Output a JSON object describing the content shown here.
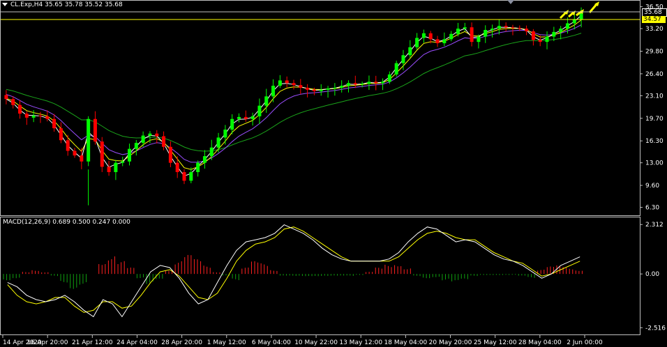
{
  "main_panel": {
    "symbol_info": "CL.Exp,H4  35.65 35.78 35.52 35.68",
    "price_axis_labels": [
      "36.50",
      "33.20",
      "29.80",
      "26.40",
      "23.10",
      "19.70",
      "16.30",
      "13.00",
      "9.60",
      "6.30"
    ],
    "price_axis_values": [
      36.5,
      33.2,
      29.8,
      26.4,
      23.1,
      19.7,
      16.3,
      13.0,
      9.6,
      6.3
    ],
    "bid_tag": "35.68",
    "ask_tag": "34.57",
    "ylim": [
      5.2,
      37.3
    ],
    "close_series": [
      22.6,
      21.7,
      20.4,
      19.8,
      20.1,
      20.0,
      19.6,
      18.2,
      16.4,
      14.8,
      14.1,
      13.2,
      19.6,
      16.2,
      12.4,
      11.6,
      13.0,
      13.2,
      15.1,
      16.0,
      17.1,
      17.4,
      17.0,
      15.4,
      13.0,
      11.6,
      10.3,
      11.6,
      13.0,
      14.0,
      15.3,
      16.8,
      18.0,
      19.6,
      19.9,
      19.6,
      20.0,
      21.6,
      23.0,
      24.6,
      25.4,
      25.0,
      24.7,
      24.3,
      24.0,
      23.8,
      24.0,
      24.2,
      24.3,
      24.6,
      25.0,
      24.8,
      24.9,
      25.2,
      25.0,
      25.2,
      26.3,
      28.0,
      29.2,
      30.4,
      31.8,
      32.5,
      31.6,
      31.0,
      31.6,
      32.4,
      33.2,
      33.4,
      31.2,
      32.0,
      33.0,
      33.2,
      33.6,
      33.4,
      33.3,
      33.2,
      32.8,
      31.5,
      31.2,
      32.0,
      32.7,
      33.2,
      34.0,
      34.57,
      35.68
    ],
    "indicator_colors": {
      "bull_candle": "#00ff00",
      "bear_candle": "#ff0000",
      "ma_fast": "#ffffff",
      "ma_mid": "#ffff00",
      "ma_slow": "#9a4dff",
      "ma_long": "#1aa31a",
      "signal_arrows": "#ffff00",
      "ask_line": "#ffff00",
      "bid_line": "#c0c0c0"
    }
  },
  "macd_panel": {
    "info": "MACD(12,26,9) 0.689 0.500 0.247 0.000",
    "axis_labels": [
      "2.312",
      "0.00",
      "-2.516"
    ],
    "axis_values": [
      2.312,
      0.0,
      -2.516
    ],
    "ylim": [
      -2.7,
      2.45
    ],
    "macd_line": [
      -0.4,
      -0.6,
      -1.0,
      -1.2,
      -1.3,
      -1.2,
      -1.0,
      -1.3,
      -1.7,
      -2.0,
      -1.2,
      -1.4,
      -2.0,
      -1.3,
      -0.6,
      0.1,
      0.4,
      0.3,
      -0.2,
      -0.9,
      -1.4,
      -1.2,
      -0.4,
      0.4,
      1.1,
      1.5,
      1.6,
      1.7,
      1.9,
      2.3,
      2.1,
      1.9,
      1.6,
      1.2,
      0.9,
      0.7,
      0.6,
      0.6,
      0.6,
      0.6,
      0.7,
      1.0,
      1.5,
      1.9,
      2.2,
      2.1,
      1.8,
      1.5,
      1.6,
      1.5,
      1.2,
      0.9,
      0.7,
      0.6,
      0.4,
      0.1,
      -0.2,
      0.0,
      0.4,
      0.6,
      0.8
    ],
    "signal_line": [
      -0.5,
      -1.0,
      -1.3,
      -1.4,
      -1.3,
      -1.1,
      -1.1,
      -1.5,
      -1.8,
      -1.7,
      -1.3,
      -1.3,
      -1.6,
      -1.5,
      -1.0,
      -0.4,
      0.1,
      0.2,
      -0.1,
      -0.6,
      -1.1,
      -1.2,
      -0.9,
      -0.2,
      0.6,
      1.1,
      1.4,
      1.5,
      1.7,
      2.1,
      2.2,
      2.0,
      1.7,
      1.4,
      1.1,
      0.8,
      0.6,
      0.6,
      0.6,
      0.6,
      0.6,
      0.8,
      1.2,
      1.6,
      1.9,
      2.0,
      1.9,
      1.7,
      1.6,
      1.6,
      1.3,
      1.0,
      0.8,
      0.6,
      0.5,
      0.2,
      -0.1,
      0.0,
      0.2,
      0.4,
      0.6
    ],
    "histogram": [
      -0.3,
      -0.2,
      0.1,
      0.2,
      0.1,
      -0.1,
      -0.4,
      -0.7,
      -0.5,
      0.0,
      0.6,
      0.9,
      0.6,
      0.3,
      -0.2,
      -0.5,
      -0.3,
      0.2,
      0.6,
      0.9,
      0.7,
      0.4,
      0.1,
      -0.1,
      -0.3,
      0.3,
      0.6,
      0.5,
      0.2,
      -0.1,
      -0.1,
      -0.1,
      -0.1,
      -0.1,
      -0.1,
      -0.1,
      -0.1,
      -0.05,
      0.1,
      0.3,
      0.45,
      0.5,
      0.3,
      -0.1,
      -0.2,
      -0.15,
      -0.3,
      -0.4,
      -0.3,
      -0.1,
      -0.05,
      -0.05,
      -0.05,
      -0.05,
      -0.1,
      -0.2,
      0.2,
      0.35,
      0.4,
      0.3,
      0.2
    ],
    "colors": {
      "macd": "#ffffff",
      "signal": "#ffff00",
      "hist_up": "#ff2020",
      "hist_down": "#10a010"
    }
  },
  "time_axis": {
    "labels": [
      "14 Apr 2020",
      "16 Apr 20:00",
      "21 Apr 12:00",
      "24 Apr 04:00",
      "28 Apr 20:00",
      "1 May 12:00",
      "6 May 04:00",
      "10 May 22:00",
      "13 May 12:00",
      "18 May 04:00",
      "20 May 20:00",
      "25 May 12:00",
      "28 May 04:00",
      "2 Jun 00:00"
    ]
  }
}
